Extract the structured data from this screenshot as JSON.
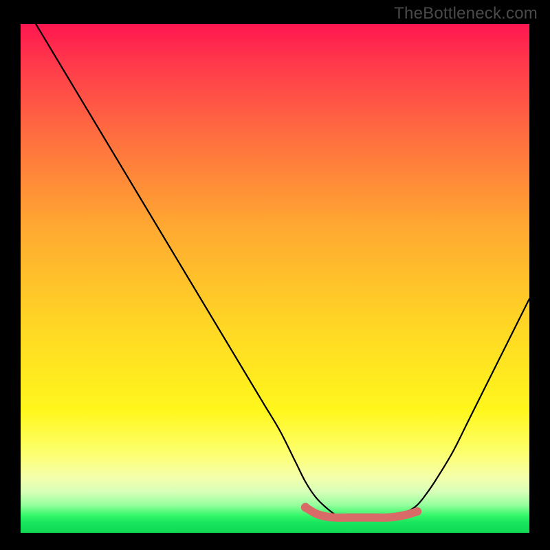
{
  "attribution": "TheBottleneck.com",
  "colors": {
    "background_black": "#000000",
    "gradient_top_red": "#ff1750",
    "gradient_mid_yellow": "#ffe522",
    "gradient_bottom_green": "#18e55d",
    "curve_stroke": "#000000",
    "highlight_stroke": "#d86a67"
  },
  "chart_data": {
    "type": "line",
    "title": "",
    "xlabel": "",
    "ylabel": "",
    "xlim": [
      0,
      100
    ],
    "ylim": [
      0,
      100
    ],
    "x": [
      3,
      6,
      9,
      12,
      15,
      18,
      21,
      24,
      27,
      30,
      33,
      36,
      39,
      42,
      45,
      48,
      51,
      54,
      56,
      58,
      60,
      62,
      64,
      66,
      68,
      70,
      72,
      74,
      76,
      78,
      80,
      82,
      85,
      88,
      91,
      94,
      97,
      100
    ],
    "values": [
      100,
      95,
      90,
      85,
      80,
      75,
      70,
      65,
      60,
      55,
      50,
      45,
      40,
      35,
      30,
      25,
      20,
      14,
      10,
      7,
      5,
      3.5,
      3,
      3,
      3,
      3,
      3.2,
      3.6,
      4.2,
      5.5,
      8,
      11,
      16,
      22,
      28,
      34,
      40,
      46
    ],
    "highlight_segment": {
      "x": [
        56,
        58,
        60,
        62,
        64,
        66,
        68,
        70,
        72,
        74,
        76,
        78
      ],
      "values": [
        5,
        3.8,
        3.2,
        3,
        3,
        3,
        3,
        3,
        3,
        3.2,
        3.6,
        4.2
      ],
      "start_dot": {
        "x": 56,
        "y": 5
      }
    }
  }
}
